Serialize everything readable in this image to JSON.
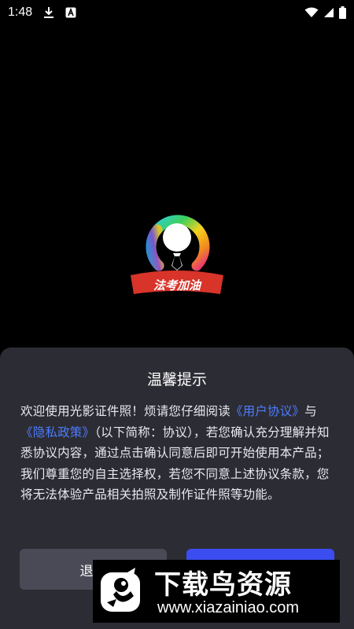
{
  "status_bar": {
    "time": "1:48",
    "icons": [
      "download-icon",
      "accessibility-app-icon",
      "wifi-icon",
      "signal-icon",
      "battery-icon"
    ]
  },
  "splash": {
    "logo_text": "法考加油"
  },
  "dialog": {
    "title": "温馨提示",
    "body": {
      "p1": "欢迎使用光影证件照！烦请您仔细阅读",
      "link_user_agreement": "《用户协议》",
      "p2": "与",
      "link_privacy_policy": "《隐私政策》",
      "p3": "（以下简称：协议），若您确认充分理解并知悉协议内容，通过点击确认同意后即可开始使用本产品；我们尊重您的自主选择权，若您不同意上述协议条款，您将无法体验产品相关拍照及制作证件照等功能。"
    },
    "exit_button": "退出",
    "agree_button": ""
  },
  "watermark": {
    "title": "下载鸟资源",
    "url": "www.xiazainiao.com"
  },
  "colors": {
    "background": "#000000",
    "dialog_bg": "#2c2c34",
    "link": "#4c7dff",
    "exit_button": "#4a4a56",
    "agree_button": "#3b4cf0",
    "logo_ribbon": "#d8342a"
  }
}
